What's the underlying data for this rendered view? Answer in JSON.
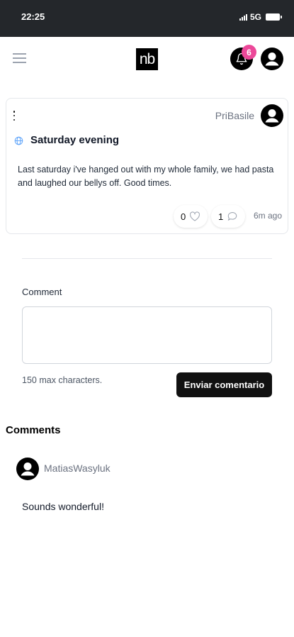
{
  "status_bar": {
    "time": "22:25",
    "network": "5G"
  },
  "navbar": {
    "logo_text": "nb",
    "notification_count": "6",
    "badge_color": "#ec4899"
  },
  "post": {
    "author": "PriBasile",
    "visibility_icon": "globe-icon",
    "title": "Saturday evening",
    "body": "Last saturday i've hanged out with my whole family, we had pasta and laughed our bellys off. Good times.",
    "likes": "0",
    "comments": "1",
    "time": "6m ago"
  },
  "comment_form": {
    "label": "Comment",
    "value": "",
    "hint": "150 max characters.",
    "submit_label": "Enviar comentario"
  },
  "comments_section": {
    "heading": "Comments",
    "items": [
      {
        "author": "MatiasWasyluk",
        "text": "Sounds wonderful!"
      }
    ]
  }
}
